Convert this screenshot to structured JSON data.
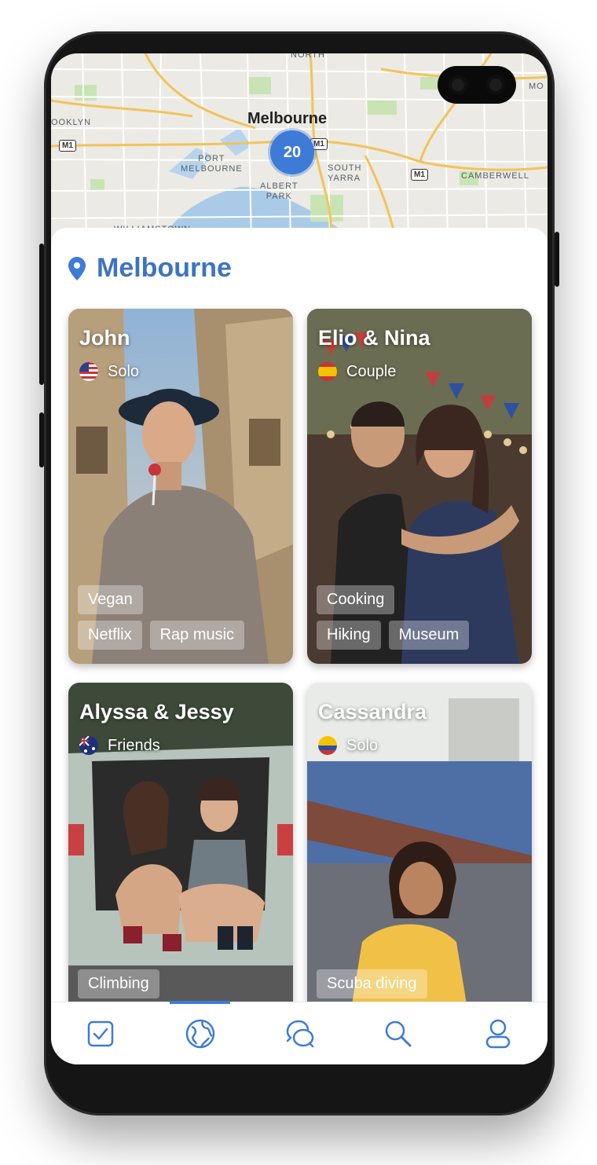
{
  "map": {
    "city_label": "Melbourne",
    "cluster_count": "20",
    "labels": {
      "north": "NORTH",
      "brooklyn": "OOKLYN",
      "port_melbourne": "PORT\nMELBOURNE",
      "south_yarra": "SOUTH\nYARRA",
      "albert_park": "ALBERT\nPARK",
      "camberwell": "CAMBERWELL",
      "mo": "MO",
      "williamstown": "WILLIAMSTOWN"
    },
    "road_signs": [
      "M1",
      "M1",
      "M1"
    ]
  },
  "location": {
    "title": "Melbourne",
    "icon": "location-pin-icon"
  },
  "cards": [
    {
      "name": "John",
      "type": "Solo",
      "flag": "us-flag-icon",
      "tags": [
        [
          "Vegan"
        ],
        [
          "Netflix",
          "Rap music"
        ]
      ]
    },
    {
      "name": "Elio & Nina",
      "type": "Couple",
      "flag": "spain-flag-icon",
      "tags": [
        [
          "Cooking"
        ],
        [
          "Hiking",
          "Museum"
        ]
      ]
    },
    {
      "name": "Alyssa & Jessy",
      "type": "Friends",
      "flag": "australia-flag-icon",
      "tags": [
        [
          "Climbing"
        ]
      ]
    },
    {
      "name": "Cassandra",
      "type": "Solo",
      "flag": "colombia-flag-icon",
      "tags": [
        [
          "Scuba diving"
        ]
      ]
    }
  ],
  "tabbar": {
    "tabs": [
      {
        "icon": "checkbox-icon",
        "active": false
      },
      {
        "icon": "globe-icon",
        "active": true
      },
      {
        "icon": "chat-bubbles-icon",
        "active": false
      },
      {
        "icon": "search-icon",
        "active": false
      },
      {
        "icon": "profile-icon",
        "active": false
      }
    ]
  },
  "colors": {
    "accent": "#3d7bd6",
    "title": "#3d74c2",
    "icon": "#3d7bd6"
  }
}
